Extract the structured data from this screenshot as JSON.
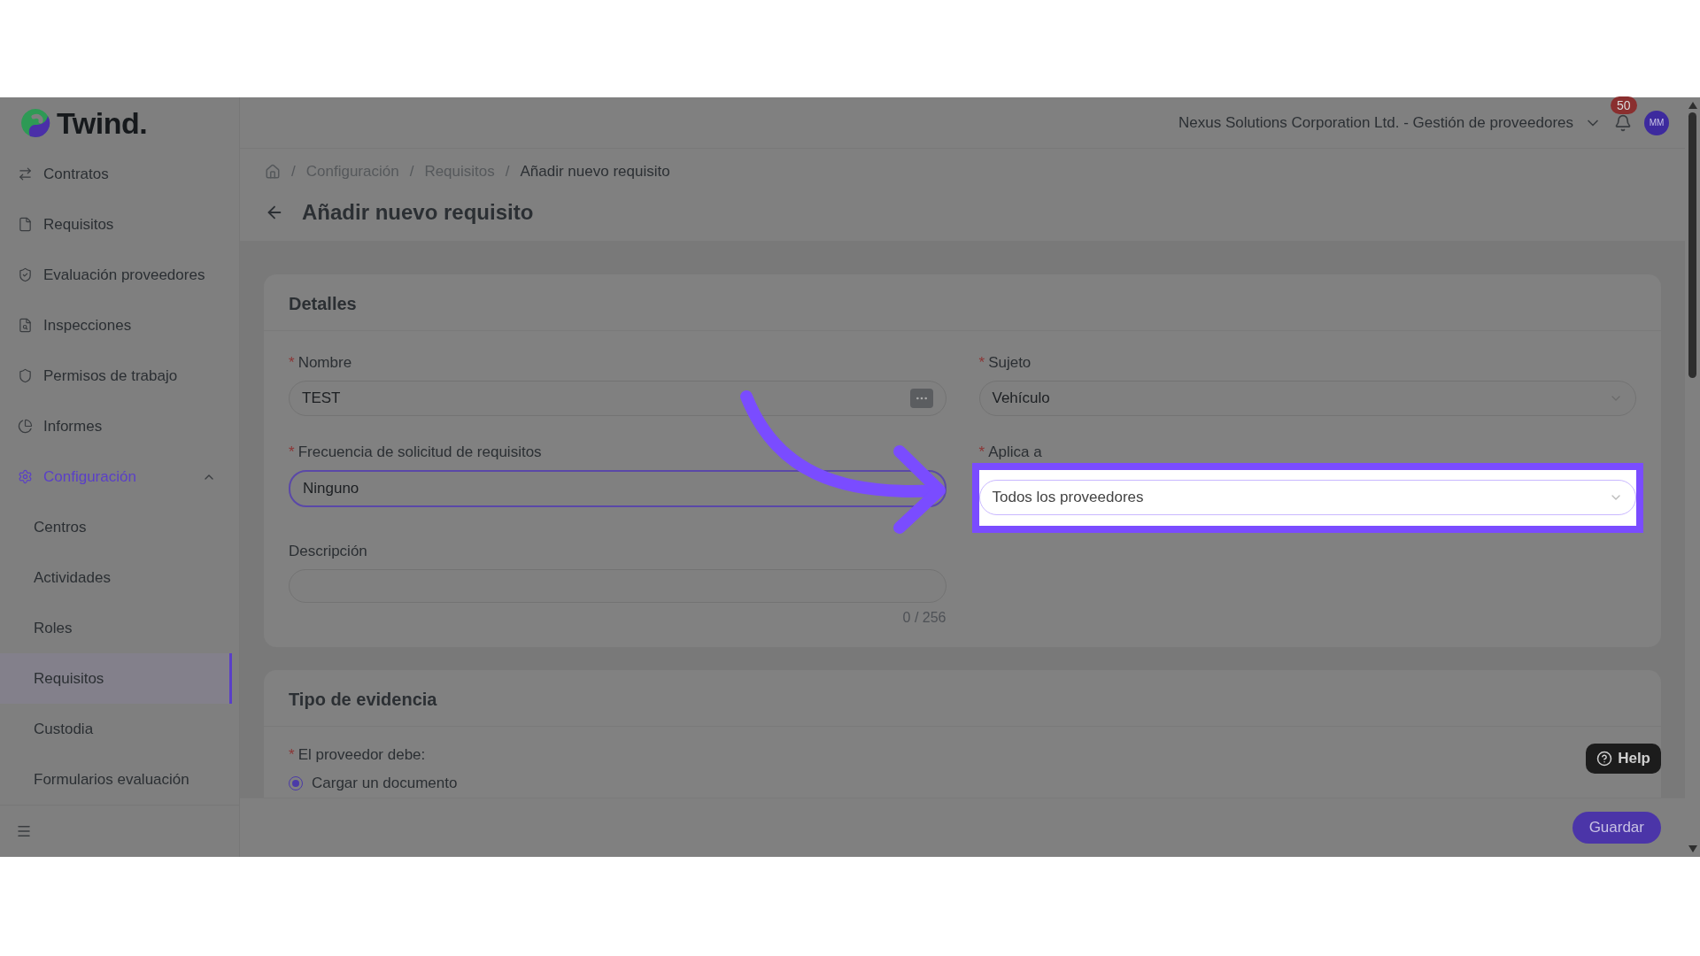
{
  "logo": {
    "text": "Twind."
  },
  "sidebar": {
    "items": [
      {
        "label": "Contratos",
        "kind": "contracts",
        "selected": false
      },
      {
        "label": "Requisitos",
        "kind": "document",
        "selected": false
      },
      {
        "label": "Evaluación proveedores",
        "kind": "shieldcheck",
        "selected": false
      },
      {
        "label": "Inspecciones",
        "kind": "inspection",
        "selected": false
      },
      {
        "label": "Permisos de trabajo",
        "kind": "shield",
        "selected": false
      },
      {
        "label": "Informes",
        "kind": "chart",
        "selected": false
      },
      {
        "label": "Configuración",
        "kind": "settings",
        "selected": true,
        "expanded": true,
        "children": [
          {
            "label": "Centros",
            "selected": false
          },
          {
            "label": "Actividades",
            "selected": false
          },
          {
            "label": "Roles",
            "selected": false
          },
          {
            "label": "Requisitos",
            "selected": true
          },
          {
            "label": "Custodia",
            "selected": false
          },
          {
            "label": "Formularios evaluación",
            "selected": false
          }
        ]
      }
    ]
  },
  "topbar": {
    "organization": "Nexus Solutions Corporation Ltd. - Gestión de proveedores",
    "notifications": "50",
    "avatar": "MM"
  },
  "breadcrumb": [
    {
      "separator": "/",
      "label": "Configuración",
      "current": false
    },
    {
      "separator": "/",
      "label": "Requisitos",
      "current": false
    },
    {
      "separator": "/",
      "label": "Añadir nuevo requisito",
      "current": true
    }
  ],
  "title": "Añadir nuevo requisito",
  "details": {
    "title": "Detalles",
    "fields": [
      {
        "mark": "*",
        "label": "Nombre",
        "kind": "action",
        "value": "TEST",
        "focused": false,
        "highlighted": false
      },
      {
        "mark": "*",
        "label": "Sujeto",
        "kind": "select",
        "value": "Vehículo",
        "focused": false,
        "highlighted": false
      },
      {
        "mark": "*",
        "label": "Frecuencia de solicitud de requisitos",
        "kind": "input",
        "value": "Ninguno",
        "focused": true,
        "highlighted": false
      },
      {
        "mark": "*",
        "label": "Aplica a",
        "kind": "select",
        "value": "Todos los proveedores",
        "focused": false,
        "highlighted": true
      },
      {
        "label": "Descripción",
        "kind": "textarea",
        "counter": "0 / 256",
        "focused": false,
        "highlighted": false
      }
    ]
  },
  "evidence": {
    "title": "Tipo de evidencia",
    "mark": "*",
    "question": "El proveedor debe:",
    "options": [
      {
        "label": "Cargar un documento",
        "selected": true
      }
    ]
  },
  "help": "Help",
  "save": "Guardar"
}
